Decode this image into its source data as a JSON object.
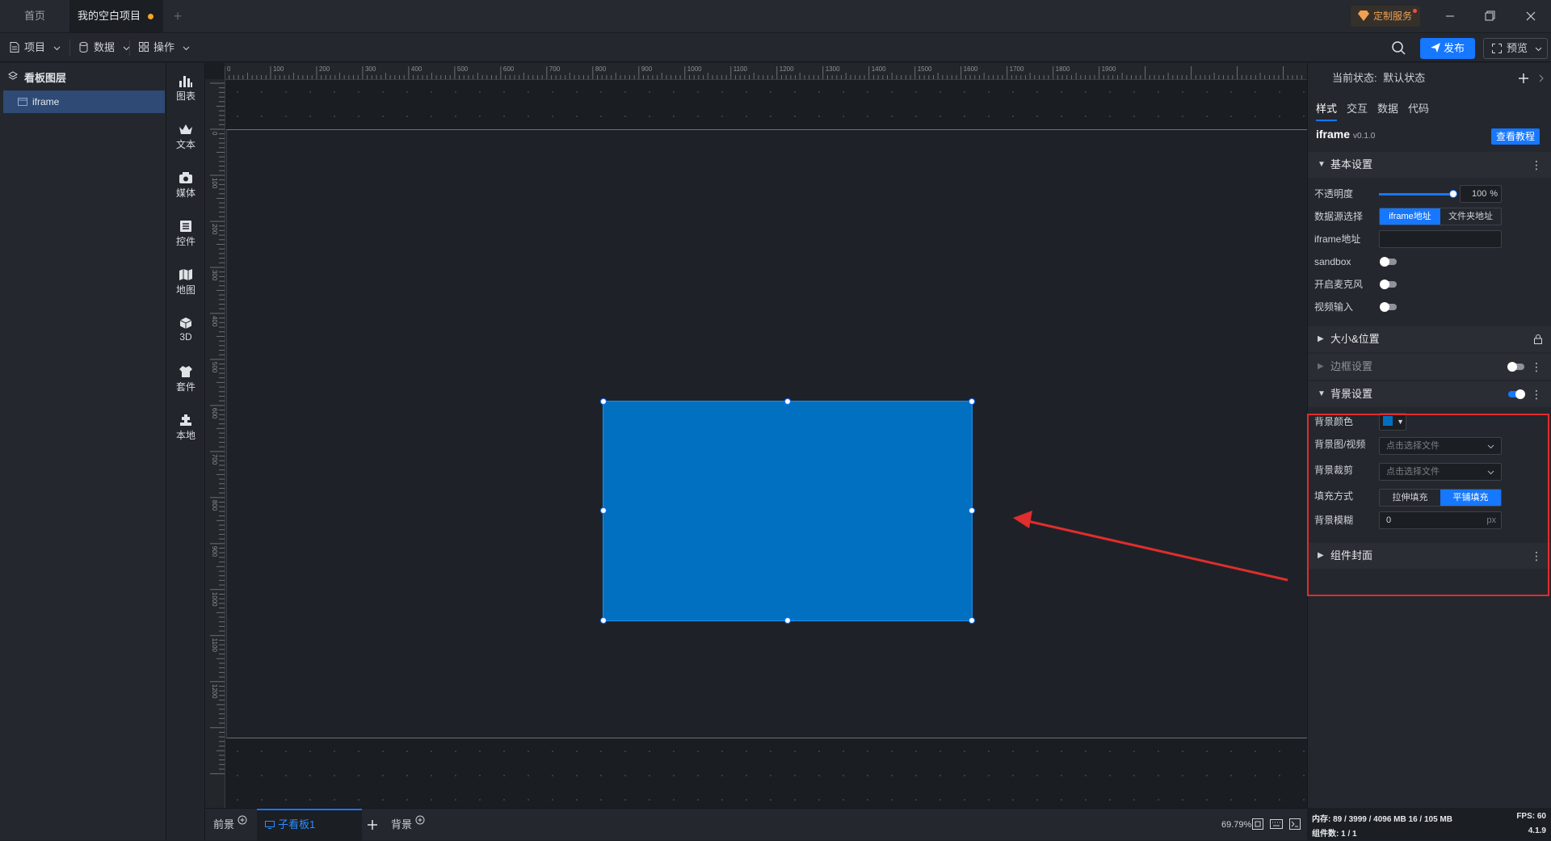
{
  "titlebar": {
    "tabs": [
      {
        "label": "首页"
      },
      {
        "label": "我的空白项目"
      }
    ],
    "service_label": "定制服务"
  },
  "toolbar": {
    "menus": [
      {
        "label": "项目",
        "icon": "file-icon"
      },
      {
        "label": "数据",
        "icon": "database-icon"
      },
      {
        "label": "操作",
        "icon": "grid-icon"
      }
    ],
    "publish_label": "发布",
    "preview_label": "预览"
  },
  "layers": {
    "title": "看板图层",
    "items": [
      {
        "label": "iframe"
      }
    ]
  },
  "components": [
    {
      "label": "图表",
      "icon": "chart-icon"
    },
    {
      "label": "文本",
      "icon": "text-icon"
    },
    {
      "label": "媒体",
      "icon": "media-icon"
    },
    {
      "label": "控件",
      "icon": "control-icon"
    },
    {
      "label": "地图",
      "icon": "map-icon"
    },
    {
      "label": "3D",
      "icon": "cube-icon"
    },
    {
      "label": "套件",
      "icon": "kit-icon"
    },
    {
      "label": "本地",
      "icon": "local-icon"
    }
  ],
  "ruler": {
    "h_ticks": [
      "0",
      "100",
      "200",
      "300",
      "400",
      "500",
      "600",
      "700",
      "800",
      "900",
      "1000",
      "1100",
      "1200",
      "1300",
      "1400",
      "1500",
      "1600",
      "1700",
      "1800",
      "1900"
    ],
    "v_ticks": [
      "0",
      "100",
      "200",
      "300",
      "400",
      "500",
      "600",
      "700",
      "800",
      "900",
      "1000",
      "1100",
      "1200"
    ]
  },
  "bottom": {
    "tabs": [
      {
        "label": "前景"
      },
      {
        "label": "子看板1"
      },
      {
        "label": "背景"
      }
    ],
    "zoom": "69.79%"
  },
  "panel": {
    "state_label": "当前状态:",
    "state_value": "默认状态",
    "tabs": [
      "样式",
      "交互",
      "数据",
      "代码"
    ],
    "component_name": "iframe",
    "component_version": "v0.1.0",
    "tutorial_label": "查看教程",
    "basic": {
      "title": "基本设置",
      "opacity_label": "不透明度",
      "opacity_value": "100",
      "opacity_unit": "%",
      "opacity_fraction": 1.0,
      "source_label": "数据源选择",
      "source_options": [
        "iframe地址",
        "文件夹地址"
      ],
      "url_label": "iframe地址",
      "url_value": "",
      "sandbox_label": "sandbox",
      "mic_label": "开启麦克风",
      "video_label": "视频输入"
    },
    "size_title": "大小&位置",
    "border_title": "边框设置",
    "background": {
      "title": "背景设置",
      "color_label": "背景颜色",
      "color_value": "#0270c1",
      "image_label": "背景图/视频",
      "image_placeholder": "点击选择文件",
      "clip_label": "背景裁剪",
      "clip_placeholder": "点击选择文件",
      "fill_label": "填充方式",
      "fill_options": [
        "拉伸填充",
        "平铺填充"
      ],
      "blur_label": "背景模糊",
      "blur_value": "0",
      "blur_unit": "px"
    },
    "cover_title": "组件封面"
  },
  "status": {
    "memory": "内存: 89 / 3999 / 4096 MB 16 / 105 MB",
    "fps": "FPS: 60",
    "count": "组件数: 1 / 1",
    "version": "4.1.9"
  },
  "colors": {
    "accent": "#1677ff",
    "annotation": "#e02d2d",
    "component_fill": "#0270c1"
  }
}
